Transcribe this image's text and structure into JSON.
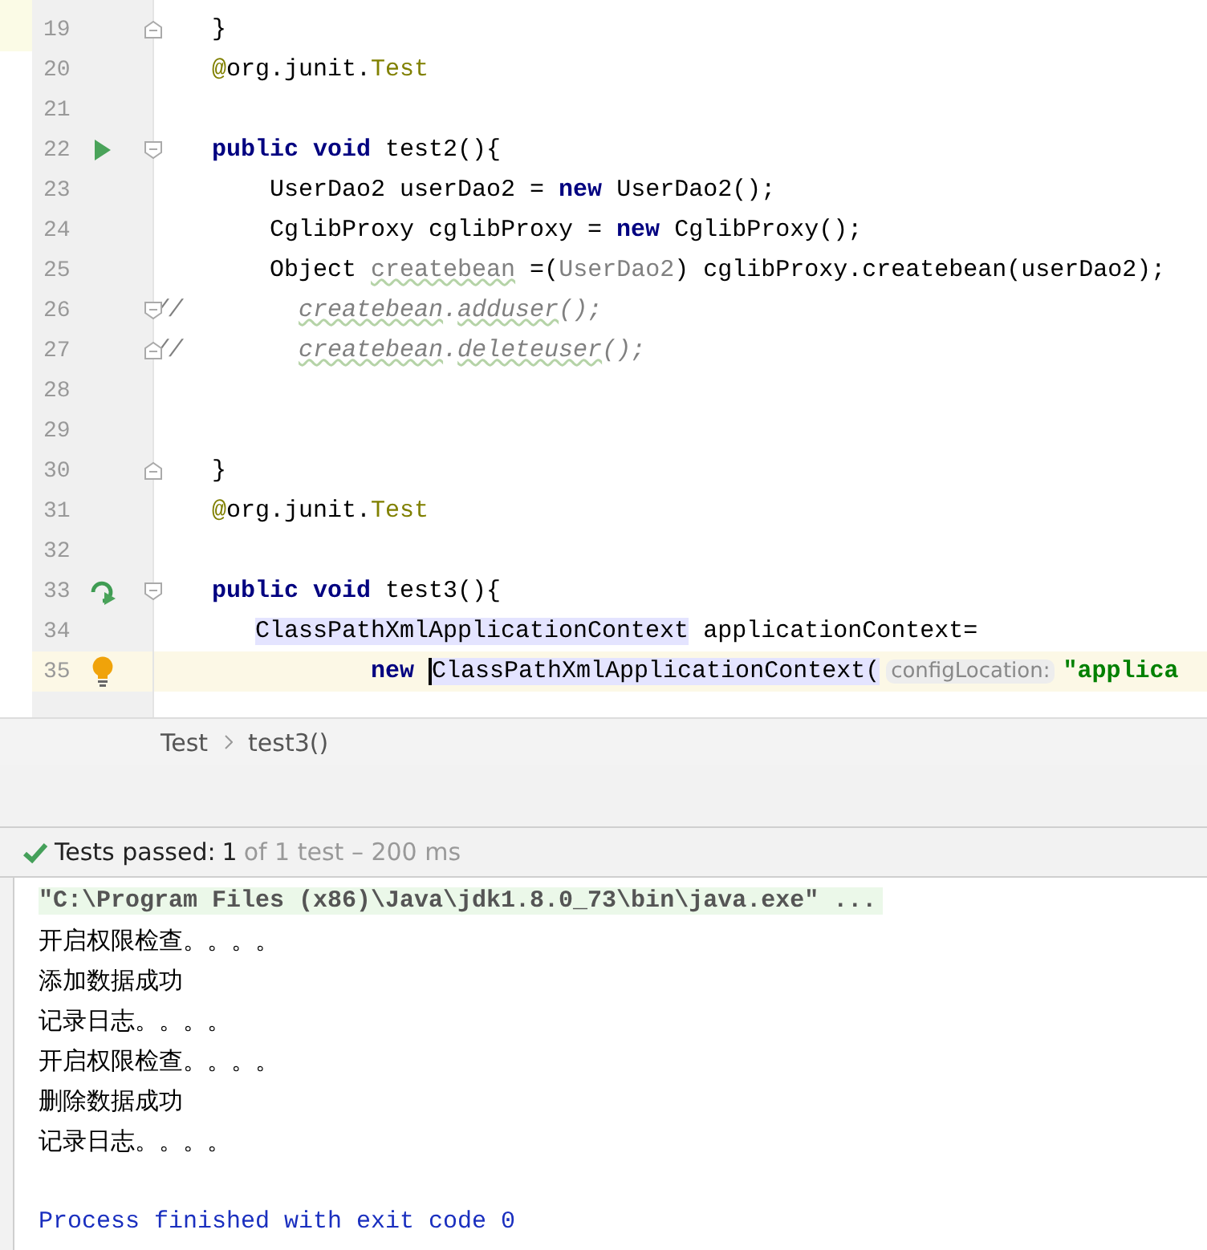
{
  "editor": {
    "lines": [
      {
        "number": "19",
        "fold_marker": {
          "kind": "end"
        },
        "current": false,
        "segments": [
          {
            "text": "    }",
            "kind": "plain"
          }
        ]
      },
      {
        "number": "20",
        "current": false,
        "segments": [
          {
            "text": "    @",
            "kind": "annotation"
          },
          {
            "text": "org.junit.",
            "kind": "plain"
          },
          {
            "text": "Test",
            "kind": "annotation"
          }
        ]
      },
      {
        "number": "21",
        "current": false
      },
      {
        "number": "22",
        "gutter_icon": {
          "kind": "run"
        },
        "fold_marker": {
          "kind": "start"
        },
        "current": false,
        "segments": [
          {
            "text": "    public void",
            "kind": "keyword"
          },
          {
            "text": " test2(){",
            "kind": "plain"
          }
        ]
      },
      {
        "number": "23",
        "current": false,
        "segments": [
          {
            "text": "        UserDao2 userDao2 = ",
            "kind": "plain"
          },
          {
            "text": "new",
            "kind": "keyword"
          },
          {
            "text": " UserDao2();",
            "kind": "plain"
          }
        ]
      },
      {
        "number": "24",
        "current": false,
        "segments": [
          {
            "text": "        CglibProxy cglibProxy = ",
            "kind": "plain"
          },
          {
            "text": "new",
            "kind": "keyword"
          },
          {
            "text": " CglibProxy();",
            "kind": "plain"
          }
        ]
      },
      {
        "number": "25",
        "current": false,
        "segments": [
          {
            "text": "        Object ",
            "kind": "plain"
          },
          {
            "text": "createbean",
            "kind": "unused"
          },
          {
            "text": " =(",
            "kind": "plain"
          },
          {
            "text": "UserDao2",
            "kind": "cast"
          },
          {
            "text": ") cglibProxy.createbean(userDao2);",
            "kind": "plain"
          }
        ]
      },
      {
        "number": "26",
        "fold_marker": {
          "kind": "start"
        },
        "current": false,
        "segments": [
          {
            "text": "//        ",
            "kind": "comment"
          },
          {
            "text": "createbean",
            "kind": "comment_warn"
          },
          {
            "text": ".",
            "kind": "comment"
          },
          {
            "text": "adduser",
            "kind": "comment_warn"
          },
          {
            "text": "();",
            "kind": "comment"
          }
        ]
      },
      {
        "number": "27",
        "fold_marker": {
          "kind": "end"
        },
        "current": false,
        "segments": [
          {
            "text": "//        ",
            "kind": "comment"
          },
          {
            "text": "createbean",
            "kind": "comment_warn"
          },
          {
            "text": ".",
            "kind": "comment"
          },
          {
            "text": "deleteuser",
            "kind": "comment_warn"
          },
          {
            "text": "();",
            "kind": "comment"
          }
        ]
      },
      {
        "number": "28",
        "current": false
      },
      {
        "number": "29",
        "current": false
      },
      {
        "number": "30",
        "fold_marker": {
          "kind": "end"
        },
        "current": false,
        "segments": [
          {
            "text": "    }",
            "kind": "plain"
          }
        ]
      },
      {
        "number": "31",
        "current": false,
        "segments": [
          {
            "text": "    @",
            "kind": "annotation"
          },
          {
            "text": "org.junit.",
            "kind": "plain"
          },
          {
            "text": "Test",
            "kind": "annotation"
          }
        ]
      },
      {
        "number": "32",
        "current": false
      },
      {
        "number": "33",
        "gutter_icon": {
          "kind": "rerun"
        },
        "fold_marker": {
          "kind": "start"
        },
        "current": false,
        "segments": [
          {
            "text": "    public void",
            "kind": "keyword"
          },
          {
            "text": " test3(){",
            "kind": "plain"
          }
        ]
      },
      {
        "number": "34",
        "current": false,
        "segments": [
          {
            "text": "       ClassPathXmlApplicationContext",
            "kind": "highlighted"
          },
          {
            "text": " applicationContext=",
            "kind": "plain"
          }
        ]
      },
      {
        "number": "35",
        "gutter_icon": {
          "kind": "bulb"
        },
        "current": true,
        "segments": [
          {
            "text": "               new ",
            "kind": "keyword"
          },
          {
            "text": "ClassPathXmlApplicationContext(",
            "kind": "highlighted",
            "caret_before": true
          },
          {
            "text": "configLocation:",
            "kind": "hint"
          },
          {
            "text": "\"applica",
            "kind": "string"
          }
        ]
      }
    ]
  },
  "breadcrumb": [
    "Test",
    "test3()"
  ],
  "test_status": {
    "passed": true,
    "label": "Tests passed:",
    "count": "1",
    "detail": "of 1 test – 200 ms"
  },
  "console": {
    "lines": [
      {
        "text": "\"C:\\Program Files (x86)\\Java\\jdk1.8.0_73\\bin\\java.exe\" ...",
        "kind": "command"
      },
      {
        "text": "开启权限检查。。。。",
        "kind": "output"
      },
      {
        "text": "添加数据成功",
        "kind": "output"
      },
      {
        "text": "记录日志。。。。",
        "kind": "output"
      },
      {
        "text": "开启权限检查。。。。",
        "kind": "output"
      },
      {
        "text": "删除数据成功",
        "kind": "output"
      },
      {
        "text": "记录日志。。。。",
        "kind": "output"
      },
      {
        "kind": "blank"
      },
      {
        "text": "Process finished with exit code 0",
        "kind": "exit"
      }
    ]
  }
}
